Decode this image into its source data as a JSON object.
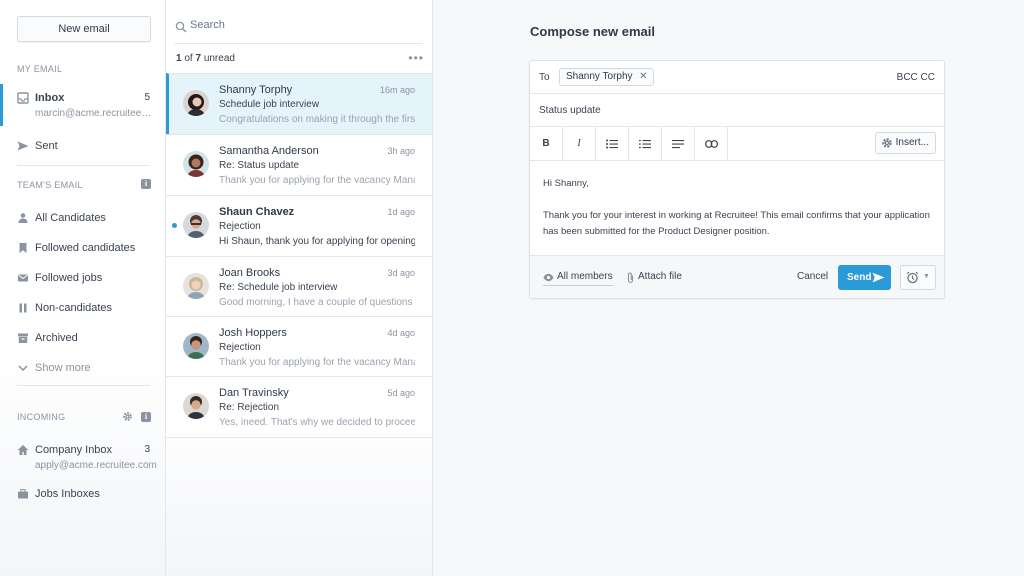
{
  "sidebar": {
    "new_email": "New email",
    "my_email_label": "MY EMAIL",
    "inbox": {
      "label": "Inbox",
      "count": "5",
      "address": "marcin@acme.recruitee.c..."
    },
    "sent": "Sent",
    "teams_email_label": "TEAM'S EMAIL",
    "team_items": [
      "All Candidates",
      "Followed candidates",
      "Followed jobs",
      "Non-candidates",
      "Archived",
      "Show more"
    ],
    "incoming_label": "INCOMING",
    "company_inbox": {
      "label": "Company Inbox",
      "count": "3",
      "address": "apply@acme.recruitee.com"
    },
    "jobs_inboxes": "Jobs Inboxes"
  },
  "list": {
    "search_placeholder": "Search",
    "unread_pos": "1",
    "unread_of": "of",
    "unread_total": "7",
    "unread_word": "unread",
    "messages": [
      {
        "name": "Shanny Torphy",
        "time": "16m ago",
        "subject": "Schedule job interview",
        "preview": "Congratulations on making it through the first s"
      },
      {
        "name": "Samantha Anderson",
        "time": "3h ago",
        "subject": "Re: Status update",
        "preview": "Thank you for applying for the vacancy Manage"
      },
      {
        "name": "Shaun Chavez",
        "time": "1d ago",
        "subject": "Rejection",
        "preview": "Hi Shaun, thank you for applying for opening"
      },
      {
        "name": "Joan Brooks",
        "time": "3d ago",
        "subject": "Re: Schedule job interview",
        "preview": "Good morning, I have a couple of questions ab"
      },
      {
        "name": "Josh Hoppers",
        "time": "4d ago",
        "subject": "Rejection",
        "preview": "Thank you for applying for the vacancy Manage"
      },
      {
        "name": "Dan Travinsky",
        "time": "5d ago",
        "subject": "Re: Rejection",
        "preview": "Yes, ineed. That's why we decided to proceed"
      }
    ]
  },
  "compose": {
    "title": "Compose new email",
    "to_label": "To",
    "recipient": "Shanny Torphy",
    "bcc_cc": "BCC CC",
    "subject": "Status update",
    "toolbar": {
      "bold": "B",
      "italic": "I",
      "insert": "Insert..."
    },
    "body_greeting": "Hi Shanny,",
    "body_text": "Thank you for your interest in working at Recruitee! This email confirms that your application has been submitted for the Product Designer position.",
    "all_members": "All members",
    "attach_file": "Attach file",
    "cancel": "Cancel",
    "send": "Send"
  },
  "colors": {
    "accent": "#2a9ad8",
    "selected_bg": "#e5f3fb",
    "unread_dot": "#2a9ad8"
  },
  "icons": [
    "search-icon",
    "inbox-icon",
    "send-icon",
    "person-icon",
    "bookmark-icon",
    "mail-icon",
    "pause-icon",
    "archive-icon",
    "chevron-down-icon",
    "gear-icon",
    "info-icon",
    "home-icon",
    "briefcase-icon",
    "more-icon",
    "close-icon",
    "list-icon",
    "numbered-list-icon",
    "align-icon",
    "link-icon",
    "eye-icon",
    "paperclip-icon",
    "alarm-clock-icon"
  ]
}
